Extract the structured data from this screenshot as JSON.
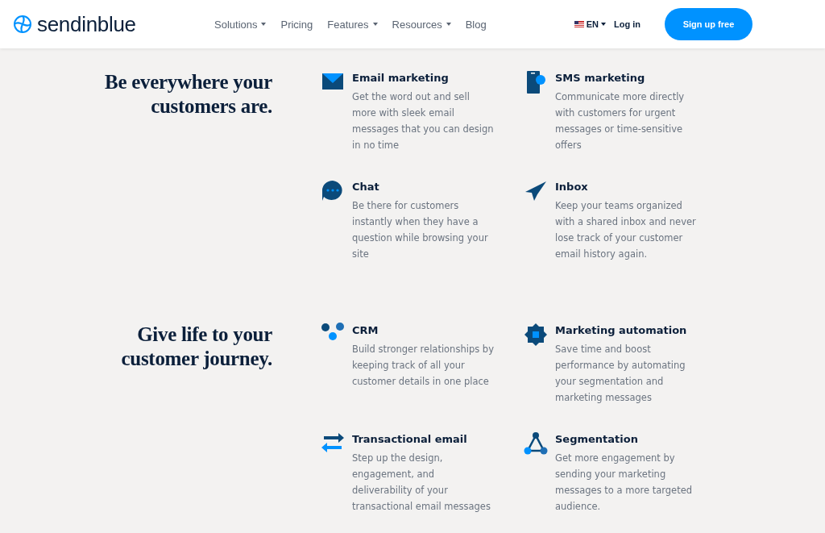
{
  "header": {
    "logo": "sendinblue",
    "nav": [
      {
        "label": "Solutions",
        "dropdown": true
      },
      {
        "label": "Pricing",
        "dropdown": false
      },
      {
        "label": "Features",
        "dropdown": true
      },
      {
        "label": "Resources",
        "dropdown": true
      },
      {
        "label": "Blog",
        "dropdown": false
      }
    ],
    "language": "EN",
    "login": "Log in",
    "signup": "Sign up free"
  },
  "sections": [
    {
      "heading": "Be everywhere your customers are.",
      "features": [
        {
          "title": "Email marketing",
          "text": "Get the word out and sell more with sleek email messages that you can design in no time"
        },
        {
          "title": "SMS marketing",
          "text": "Communicate more directly with customers for urgent messages or time-sensitive offers"
        },
        {
          "title": "Chat",
          "text": "Be there for customers instantly when they have a question while browsing your site"
        },
        {
          "title": "Inbox",
          "text": "Keep your teams organized with a shared inbox and never lose track of your customer email history again."
        }
      ]
    },
    {
      "heading": "Give life to your customer journey.",
      "features": [
        {
          "title": "CRM",
          "text": "Build stronger relationships by keeping track of all your customer details in one place"
        },
        {
          "title": "Marketing automation",
          "text": "Save time and boost performance by automating your segmentation and marketing messages"
        },
        {
          "title": "Transactional email",
          "text": "Step up the design, engagement, and deliverability of your transactional email messages"
        },
        {
          "title": "Segmentation",
          "text": "Get more engagement by sending your marketing messages to a more targeted audience."
        }
      ]
    }
  ]
}
